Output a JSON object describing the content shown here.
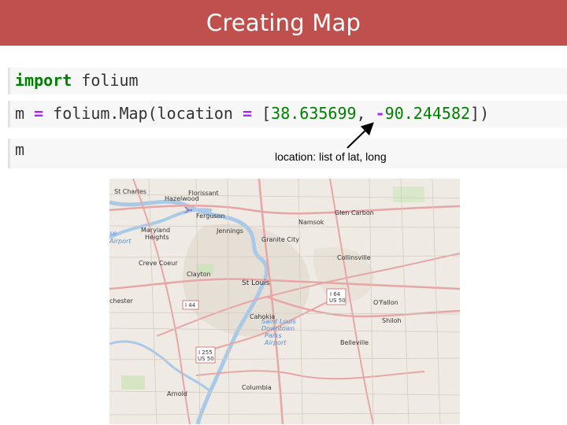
{
  "slide": {
    "title": "Creating Map"
  },
  "code": {
    "line1": {
      "keyword": "import",
      "module": " folium"
    },
    "line2": {
      "prefix": "m ",
      "eq1": "=",
      "call": " folium.Map(location ",
      "eq2": "=",
      "open": " [",
      "lat": "38.635699",
      "comma": ", ",
      "minus": "-",
      "lon": "90.244582",
      "close": "])"
    },
    "line3": "m"
  },
  "annotation": {
    "text": "location: list of lat, long"
  },
  "map": {
    "labels": {
      "st_charles": "St Charles",
      "hazelwood": "Hazelwood",
      "florissant": "Florissant",
      "ferguson": "Ferguson",
      "maryland_heights": "Maryland",
      "maryland_heights2": "Heights",
      "jennings": "Jennings",
      "glen_carbon": "Glen Carbon",
      "namsok": "Namsok",
      "granite_city": "Granite City",
      "collinsville": "Collinsville",
      "creve_coeur": "Creve Coeur",
      "clayton": "Clayton",
      "st_louis": "St Louis",
      "chesterfield": "chester",
      "ofallon": "O'Fallon",
      "cahokia": "Cahokia",
      "shiloh": "Shiloh",
      "belleville": "Belleville",
      "arnold": "Arnold",
      "columbia": "Columbia",
      "airport1": "se",
      "airport2": "Airport",
      "parks1": "Saint Louis",
      "parks2": "Downtown",
      "parks3": "Parks",
      "parks4": "Airport"
    },
    "shields": {
      "i64": "I 64",
      "us50a": "US 50",
      "i44": "I 44",
      "i255": "I 255",
      "us50b": "US 50"
    }
  }
}
